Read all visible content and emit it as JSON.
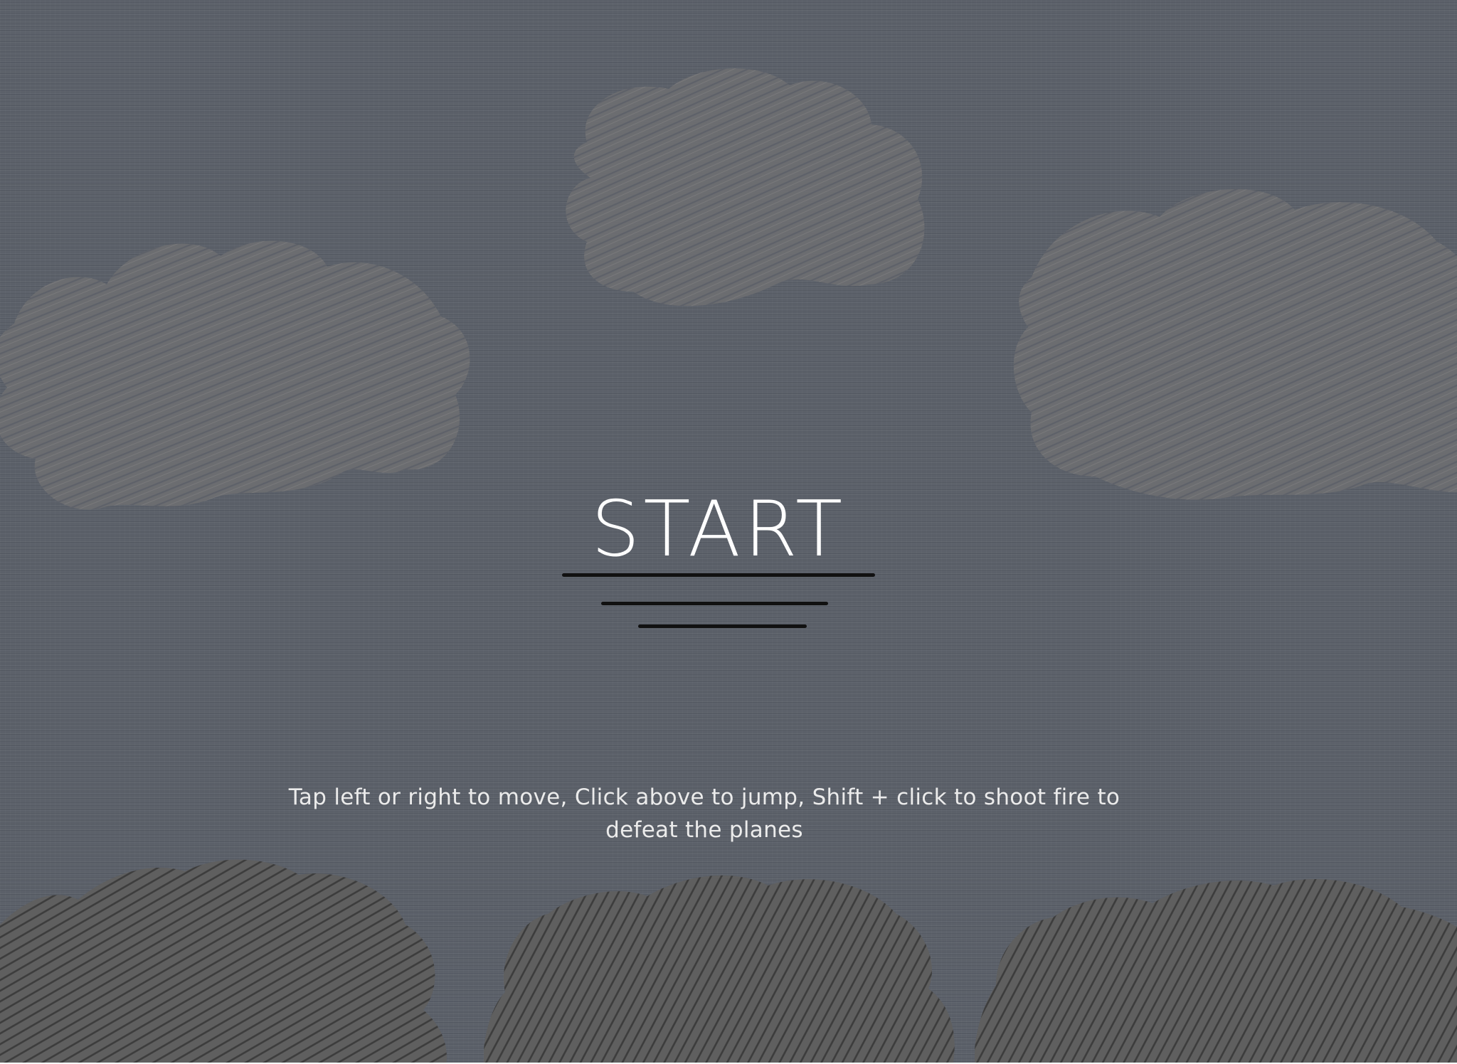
{
  "start_screen": {
    "start_label": "START",
    "instructions": "Tap left or right to move, Click above to jump, Shift + click to shoot fire to defeat the planes"
  },
  "clouds": {
    "sky_cloud_icon": "scribble-cloud-icon",
    "ground_cloud_icon": "scribble-bush-icon"
  },
  "colors": {
    "sky": "#5b6069",
    "sky_cloud": "#6e6e70",
    "ground_cloud": "#5e5e5e",
    "ground_cloud_hatch": "#3c3c3c",
    "start_text": "#ffffff",
    "underline": "#111111"
  }
}
